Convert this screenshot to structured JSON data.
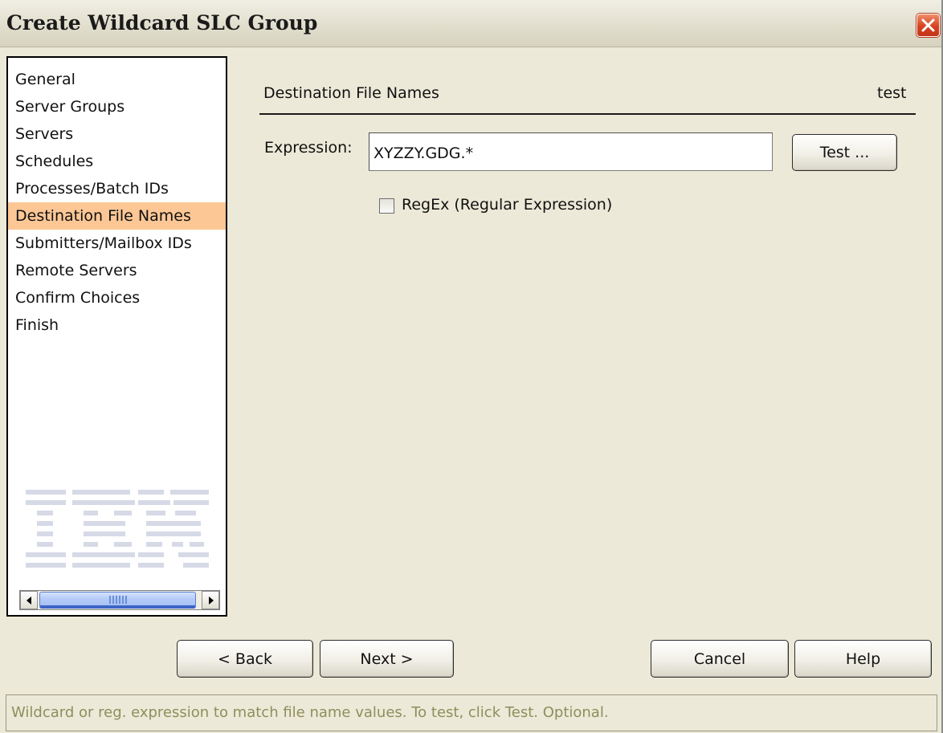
{
  "window": {
    "title": "Create Wildcard SLC Group",
    "close_icon": "close-icon"
  },
  "nav": {
    "items": [
      {
        "label": "General"
      },
      {
        "label": "Server Groups"
      },
      {
        "label": "Servers"
      },
      {
        "label": "Schedules"
      },
      {
        "label": "Processes/Batch IDs"
      },
      {
        "label": "Destination File Names"
      },
      {
        "label": "Submitters/Mailbox IDs"
      },
      {
        "label": "Remote Servers"
      },
      {
        "label": "Confirm Choices"
      },
      {
        "label": "Finish"
      }
    ],
    "selected_index": 5,
    "selected_color": "#fcc795",
    "logo_icon": "ibm-logo",
    "scroll_icons": [
      "scroll-left-icon",
      "scroll-right-icon"
    ]
  },
  "content": {
    "section_title": "Destination File Names",
    "section_tag": "test",
    "expression_label": "Expression:",
    "expression_value": "XYZZY.GDG.*",
    "test_button": "Test ...",
    "regex_label": "RegEx (Regular Expression)",
    "regex_checked": false
  },
  "footer": {
    "back_button": "< Back",
    "next_button": "Next >",
    "cancel_button": "Cancel",
    "help_button": "Help"
  },
  "status": {
    "text": "Wildcard or reg. expression to match file name values. To test, click Test. Optional.",
    "text_color": "#8d8f5c"
  },
  "colors": {
    "window_bg": "#ece9d8",
    "close_button": "#d6431f"
  }
}
